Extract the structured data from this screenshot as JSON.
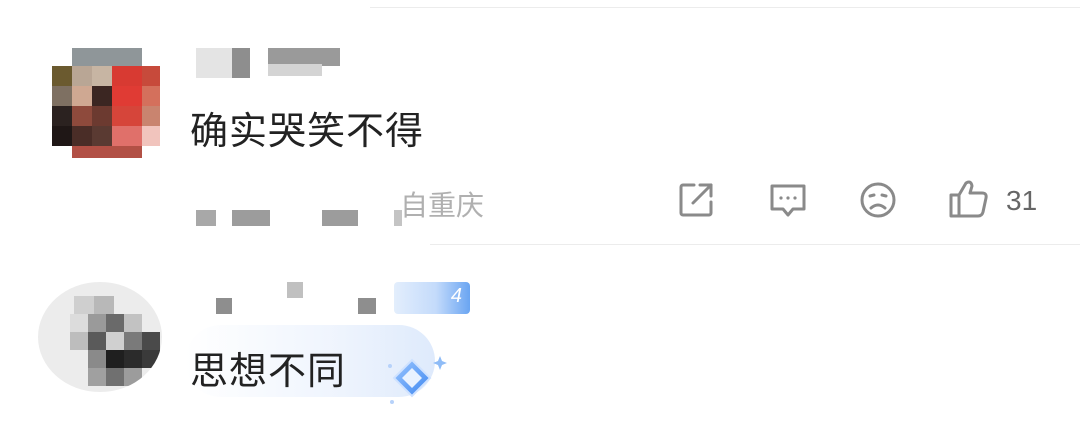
{
  "comments": [
    {
      "text": "确实哭笑不得",
      "location": "自重庆",
      "like_count": "31"
    },
    {
      "text": "思想不同",
      "badge_text": "4"
    }
  ],
  "icons": {
    "share": "share-icon",
    "comment": "comment-icon",
    "dislike": "sad-face-icon",
    "like": "thumbs-up-icon",
    "decoration": "diamond-sparkle-icon"
  },
  "colors": {
    "text": "#222222",
    "secondary": "#b0b0b0",
    "icon": "#8a8a8a",
    "badge": "#6aa5f2"
  }
}
